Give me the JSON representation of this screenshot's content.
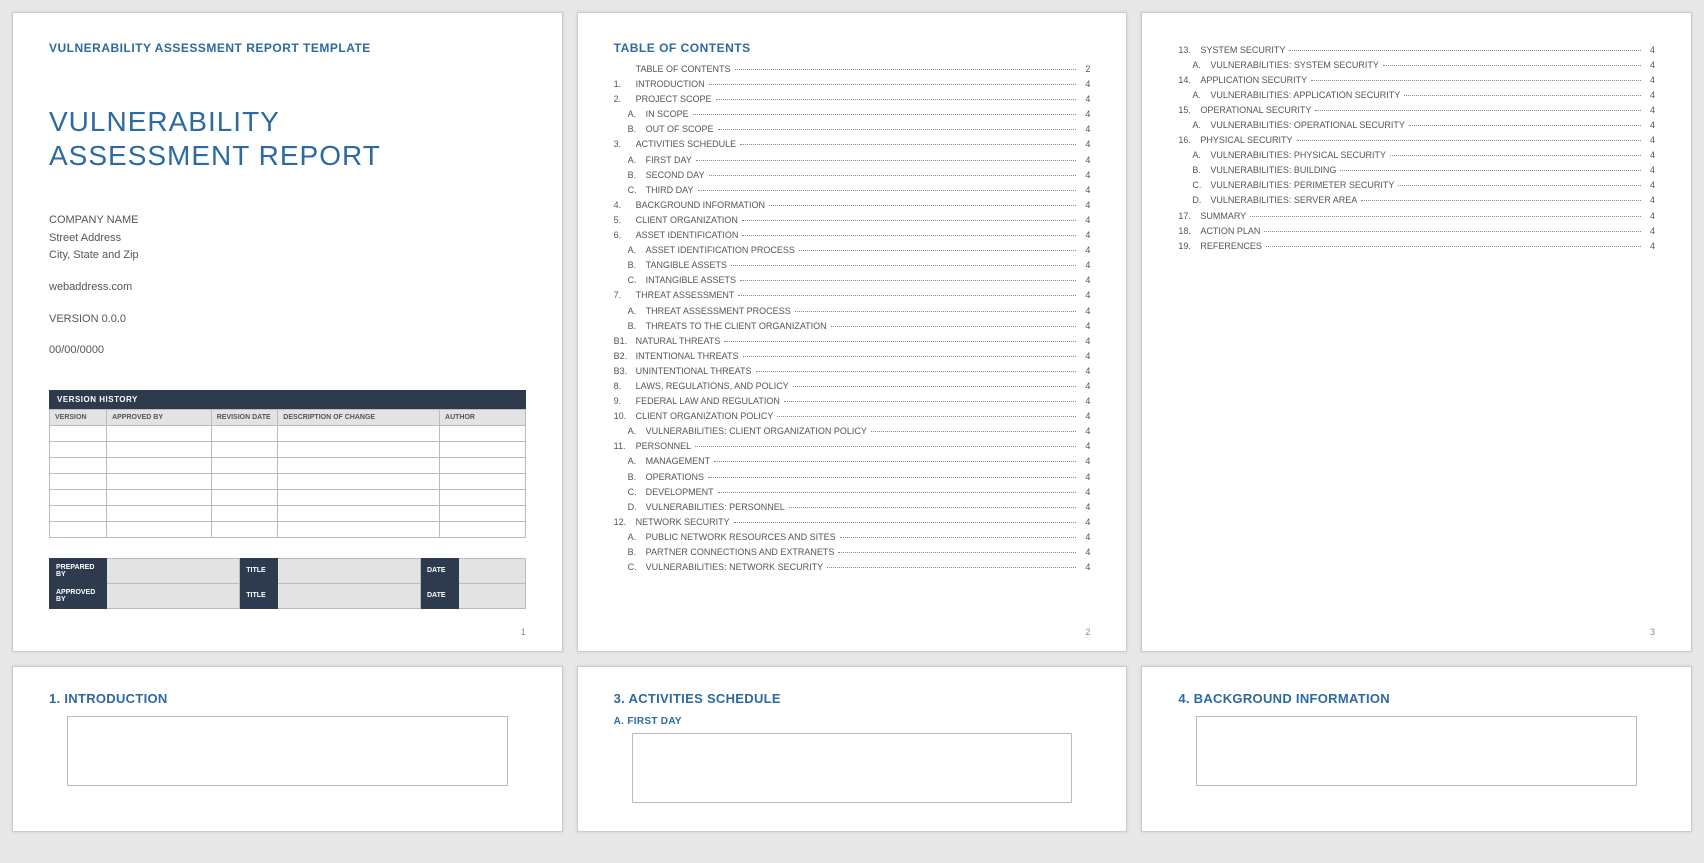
{
  "headerBand": "VULNERABILITY ASSESSMENT REPORT TEMPLATE",
  "title1": "VULNERABILITY",
  "title2": "ASSESSMENT REPORT",
  "company": "COMPANY NAME",
  "street": "Street Address",
  "cityStateZip": "City, State and Zip",
  "web": "webaddress.com",
  "version": "VERSION 0.0.0",
  "date": "00/00/0000",
  "vhTitle": "VERSION HISTORY",
  "vhHeaders": {
    "version": "VERSION",
    "approvedBy": "APPROVED BY",
    "revisionDate": "REVISION DATE",
    "description": "DESCRIPTION OF CHANGE",
    "author": "AUTHOR"
  },
  "sig": {
    "preparedBy": "PREPARED BY",
    "approvedBy": "APPROVED BY",
    "title": "TITLE",
    "date": "DATE"
  },
  "page1": "1",
  "page2": "2",
  "page3": "3",
  "tocTitle": "TABLE OF CONTENTS",
  "tocA": [
    {
      "n": "",
      "t": "TABLE OF CONTENTS",
      "p": "2",
      "sub": false
    },
    {
      "n": "1.",
      "t": "INTRODUCTION",
      "p": "4",
      "sub": false
    },
    {
      "n": "2.",
      "t": "PROJECT SCOPE",
      "p": "4",
      "sub": false
    },
    {
      "n": "A.",
      "t": "IN SCOPE",
      "p": "4",
      "sub": true
    },
    {
      "n": "B.",
      "t": "OUT OF SCOPE",
      "p": "4",
      "sub": true
    },
    {
      "n": "3.",
      "t": "ACTIVITIES SCHEDULE",
      "p": "4",
      "sub": false
    },
    {
      "n": "A.",
      "t": "FIRST DAY",
      "p": "4",
      "sub": true
    },
    {
      "n": "B.",
      "t": "SECOND DAY",
      "p": "4",
      "sub": true
    },
    {
      "n": "C.",
      "t": "THIRD DAY",
      "p": "4",
      "sub": true
    },
    {
      "n": "4.",
      "t": "BACKGROUND INFORMATION",
      "p": "4",
      "sub": false
    },
    {
      "n": "5.",
      "t": "CLIENT ORGANIZATION",
      "p": "4",
      "sub": false
    },
    {
      "n": "6.",
      "t": "ASSET IDENTIFICATION",
      "p": "4",
      "sub": false
    },
    {
      "n": "A.",
      "t": "ASSET IDENTIFICATION PROCESS",
      "p": "4",
      "sub": true
    },
    {
      "n": "B.",
      "t": "TANGIBLE ASSETS",
      "p": "4",
      "sub": true
    },
    {
      "n": "C.",
      "t": "INTANGIBLE ASSETS",
      "p": "4",
      "sub": true
    },
    {
      "n": "7.",
      "t": "THREAT ASSESSMENT",
      "p": "4",
      "sub": false
    },
    {
      "n": "A.",
      "t": "THREAT ASSESSMENT PROCESS",
      "p": "4",
      "sub": true
    },
    {
      "n": "B.",
      "t": "THREATS TO THE CLIENT ORGANIZATION",
      "p": "4",
      "sub": true
    },
    {
      "n": "B1.",
      "t": "NATURAL THREATS",
      "p": "4",
      "sub": false
    },
    {
      "n": "B2.",
      "t": "INTENTIONAL THREATS",
      "p": "4",
      "sub": false
    },
    {
      "n": "B3.",
      "t": "UNINTENTIONAL THREATS",
      "p": "4",
      "sub": false
    },
    {
      "n": "8.",
      "t": "LAWS, REGULATIONS, AND POLICY",
      "p": "4",
      "sub": false
    },
    {
      "n": "9.",
      "t": "FEDERAL LAW AND REGULATION",
      "p": "4",
      "sub": false
    },
    {
      "n": "10.",
      "t": "CLIENT ORGANIZATION POLICY",
      "p": "4",
      "sub": false
    },
    {
      "n": "A.",
      "t": "VULNERABILITIES: CLIENT ORGANIZATION POLICY",
      "p": "4",
      "sub": true
    },
    {
      "n": "11.",
      "t": "PERSONNEL",
      "p": "4",
      "sub": false
    },
    {
      "n": "A.",
      "t": "MANAGEMENT",
      "p": "4",
      "sub": true
    },
    {
      "n": "B.",
      "t": "OPERATIONS",
      "p": "4",
      "sub": true
    },
    {
      "n": "C.",
      "t": "DEVELOPMENT",
      "p": "4",
      "sub": true
    },
    {
      "n": "D.",
      "t": "VULNERABILITIES: PERSONNEL",
      "p": "4",
      "sub": true
    },
    {
      "n": "12.",
      "t": "NETWORK SECURITY",
      "p": "4",
      "sub": false
    },
    {
      "n": "A.",
      "t": "PUBLIC NETWORK RESOURCES AND SITES",
      "p": "4",
      "sub": true
    },
    {
      "n": "B.",
      "t": "PARTNER CONNECTIONS AND EXTRANETS",
      "p": "4",
      "sub": true
    },
    {
      "n": "C.",
      "t": "VULNERABILITIES: NETWORK SECURITY",
      "p": "4",
      "sub": true
    }
  ],
  "tocB": [
    {
      "n": "13.",
      "t": "SYSTEM SECURITY",
      "p": "4",
      "sub": false
    },
    {
      "n": "A.",
      "t": "VULNERABILITIES: SYSTEM SECURITY",
      "p": "4",
      "sub": true
    },
    {
      "n": "14.",
      "t": "APPLICATION SECURITY",
      "p": "4",
      "sub": false
    },
    {
      "n": "A.",
      "t": "VULNERABILITIES: APPLICATION SECURITY",
      "p": "4",
      "sub": true
    },
    {
      "n": "15.",
      "t": "OPERATIONAL SECURITY",
      "p": "4",
      "sub": false
    },
    {
      "n": "A.",
      "t": "VULNERABILITIES: OPERATIONAL SECURITY",
      "p": "4",
      "sub": true
    },
    {
      "n": "16.",
      "t": "PHYSICAL SECURITY",
      "p": "4",
      "sub": false
    },
    {
      "n": "A.",
      "t": "VULNERABILITIES: PHYSICAL SECURITY",
      "p": "4",
      "sub": true
    },
    {
      "n": "B.",
      "t": "VULNERABILITIES: BUILDING",
      "p": "4",
      "sub": true
    },
    {
      "n": "C.",
      "t": "VULNERABILITIES: PERIMETER SECURITY",
      "p": "4",
      "sub": true
    },
    {
      "n": "D.",
      "t": "VULNERABILITIES: SERVER AREA",
      "p": "4",
      "sub": true
    },
    {
      "n": "17.",
      "t": "SUMMARY",
      "p": "4",
      "sub": false
    },
    {
      "n": "18.",
      "t": "ACTION PLAN",
      "p": "4",
      "sub": false
    },
    {
      "n": "19.",
      "t": "REFERENCES",
      "p": "4",
      "sub": false
    }
  ],
  "sec1": "1. INTRODUCTION",
  "sec3": "3. ACTIVITIES SCHEDULE",
  "sec3a": "A. FIRST DAY",
  "sec4": "4. BACKGROUND INFORMATION"
}
